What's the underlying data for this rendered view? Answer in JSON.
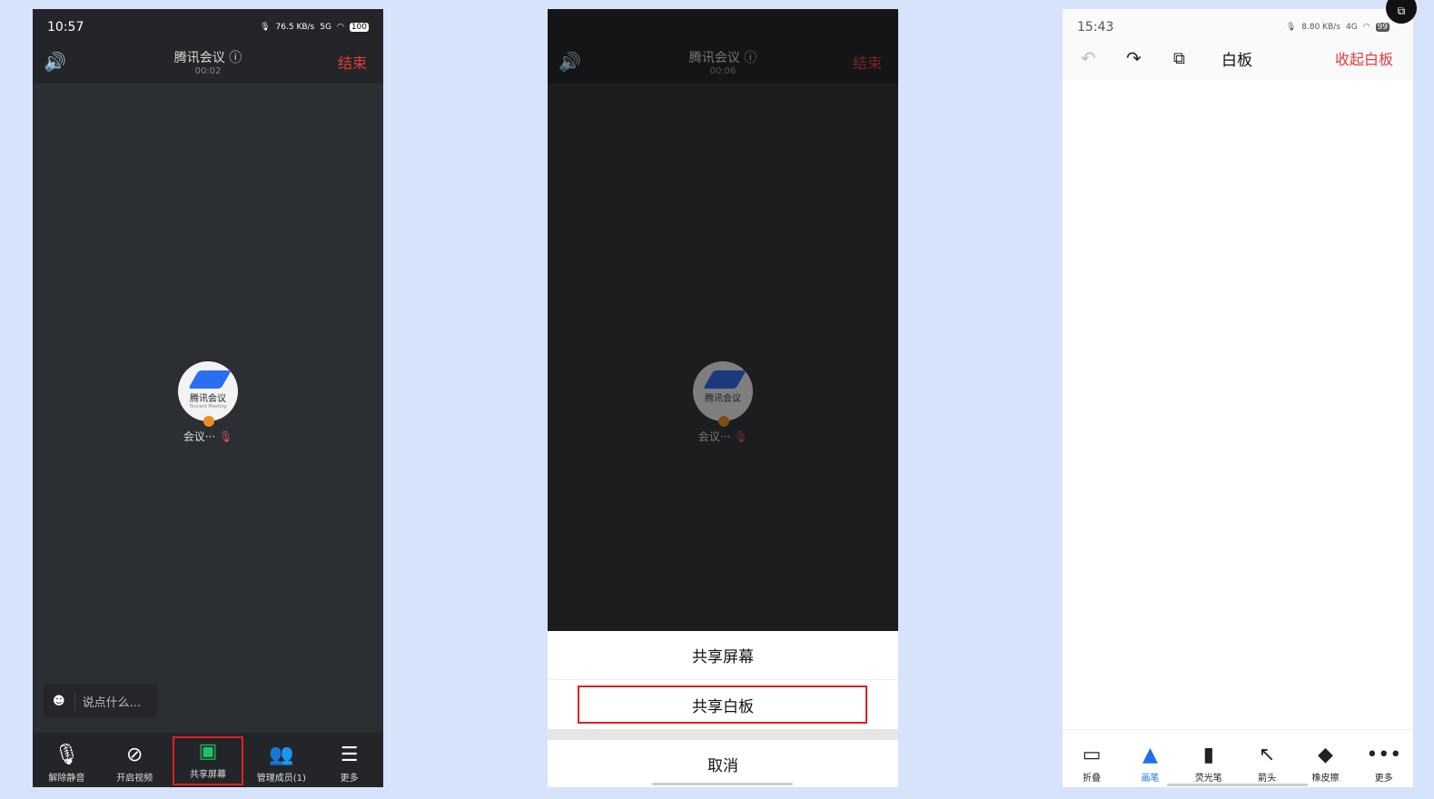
{
  "colors": {
    "accent_red": "#e23c3c",
    "accent_blue": "#1e6ff0",
    "highlight_box": "#e02020"
  },
  "panel1": {
    "status": {
      "time": "10:57",
      "net_speed": "76.5 KB/s",
      "network": "5G",
      "battery": "100"
    },
    "header": {
      "title": "腾讯会议",
      "duration": "00:02",
      "end_label": "结束"
    },
    "participant": {
      "logo_text": "腾讯会议",
      "logo_subtext": "Tencent Meeting",
      "name": "会议···"
    },
    "chat": {
      "placeholder": "说点什么..."
    },
    "toolbar": [
      {
        "label": "解除静音",
        "icon": "mic-muted-icon"
      },
      {
        "label": "开启视频",
        "icon": "video-off-icon"
      },
      {
        "label": "共享屏幕",
        "icon": "share-screen-icon"
      },
      {
        "label": "管理成员(1)",
        "icon": "members-icon"
      },
      {
        "label": "更多",
        "icon": "more-menu-icon"
      }
    ]
  },
  "panel2": {
    "header": {
      "title": "腾讯会议",
      "duration": "00:06",
      "end_label": "结束"
    },
    "participant": {
      "logo_text": "腾讯会议",
      "name": "会议···"
    },
    "sheet": {
      "share_screen": "共享屏幕",
      "share_whiteboard": "共享白板",
      "cancel": "取消"
    }
  },
  "panel3": {
    "status": {
      "time": "15:43",
      "net_speed": "8.80 KB/s",
      "network": "4G",
      "battery": "99"
    },
    "header": {
      "title": "白板",
      "collapse_label": "收起白板"
    },
    "toolbar": [
      {
        "label": "折叠",
        "icon": "fold-icon"
      },
      {
        "label": "画笔",
        "icon": "pen-icon",
        "active": true
      },
      {
        "label": "荧光笔",
        "icon": "highlighter-icon"
      },
      {
        "label": "箭头",
        "icon": "arrow-icon"
      },
      {
        "label": "橡皮擦",
        "icon": "eraser-icon"
      },
      {
        "label": "更多",
        "icon": "more-icon"
      }
    ]
  }
}
